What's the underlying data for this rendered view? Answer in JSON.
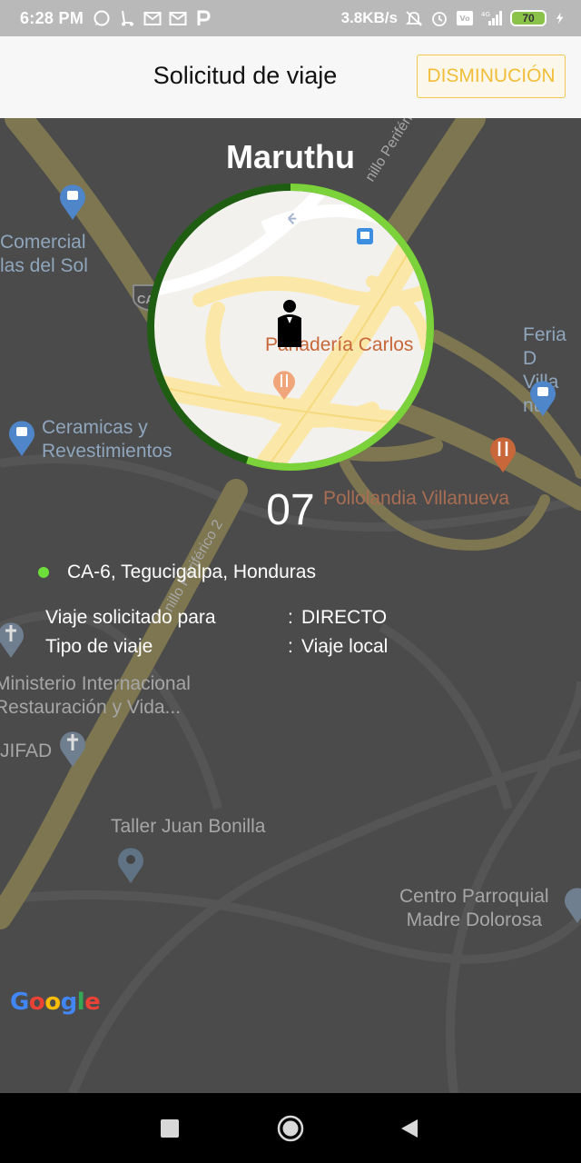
{
  "status_bar": {
    "time": "6:28 PM",
    "net_speed": "3.8KB/s",
    "battery": "70",
    "left_icons": [
      "whatsapp-icon",
      "scooter-icon",
      "gmail-icon",
      "gmail-icon",
      "p-app-icon"
    ],
    "right_icons": [
      "muted-bell-icon",
      "alarm-icon",
      "volte-icon",
      "signal-4g-icon",
      "battery-icon",
      "charging-icon"
    ]
  },
  "header": {
    "title": "Solicitud de viaje",
    "cancel_label": "DISMINUCIÓN"
  },
  "map": {
    "labels": {
      "comercial": "Comercial\nlas del Sol",
      "ceramicas": "Ceramicas y\nRevestimientos",
      "feria": "Feria D\nVilla nu",
      "pollolandia": "Pollolandia Villanueva",
      "ministerio": "Ministerio Internacional\nRestauración y Vida...",
      "jifad": "JIFAD",
      "taller": "Taller Juan Bonilla",
      "centro": "Centro Parroquial\nMadre Dolorosa",
      "anillo_top": "nillo Periférico",
      "anillo_mid": "nillo Periférico 2",
      "ca6": "CA 6",
      "panaderia": "Panadería Carlos"
    },
    "google_logo": "Google"
  },
  "request": {
    "driver_name": "Maruthu",
    "countdown": "07",
    "countdown_progress": 0.55,
    "address": "CA-6, Tegucigalpa, Honduras",
    "trip_requested_for_label": "Viaje solicitado para",
    "trip_requested_for_value": "DIRECTO",
    "trip_type_label": "Tipo de viaje",
    "trip_type_value": "Viaje local",
    "separator": ":"
  },
  "colors": {
    "accent_yellow": "#f2be3a",
    "ring_dark": "#1f5e12",
    "ring_light": "#7bd23a",
    "dot_green": "#6ddf3b"
  },
  "nav_bar": {
    "buttons": [
      "recents-button",
      "home-button",
      "back-button"
    ]
  }
}
